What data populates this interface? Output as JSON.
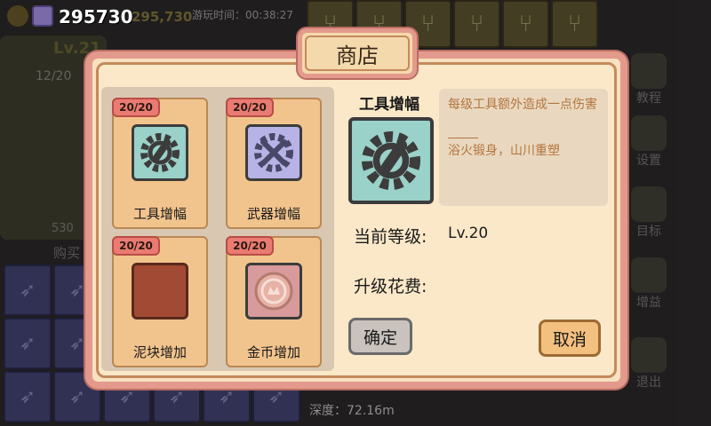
{
  "hud": {
    "coins": "295730",
    "gold": "295,730",
    "playtime": "游玩时间：00:38:27",
    "level": "Lv.21",
    "hp": "12/20",
    "resource": "530",
    "buy": "购买",
    "depth": "深度：72.16m"
  },
  "right_menu": [
    "教程",
    "设置",
    "目标",
    "增益",
    "退出"
  ],
  "dialog": {
    "title": "商店",
    "items": [
      {
        "badge": "20/20",
        "label": "工具增幅",
        "icon": "tool-gear-icon"
      },
      {
        "badge": "20/20",
        "label": "武器增幅",
        "icon": "weapon-gear-icon"
      },
      {
        "badge": "20/20",
        "label": "泥块增加",
        "icon": "mud-block-icon"
      },
      {
        "badge": "20/20",
        "label": "金币增加",
        "icon": "gold-coin-icon"
      }
    ],
    "detail": {
      "title": "工具增幅",
      "desc": "每级工具额外造成一点伤害",
      "quote": "浴火锻身，山川重塑",
      "level_label": "当前等级:",
      "level_value": "Lv.20",
      "cost_label": "升级花费:"
    },
    "confirm": "确定",
    "cancel": "取消"
  }
}
